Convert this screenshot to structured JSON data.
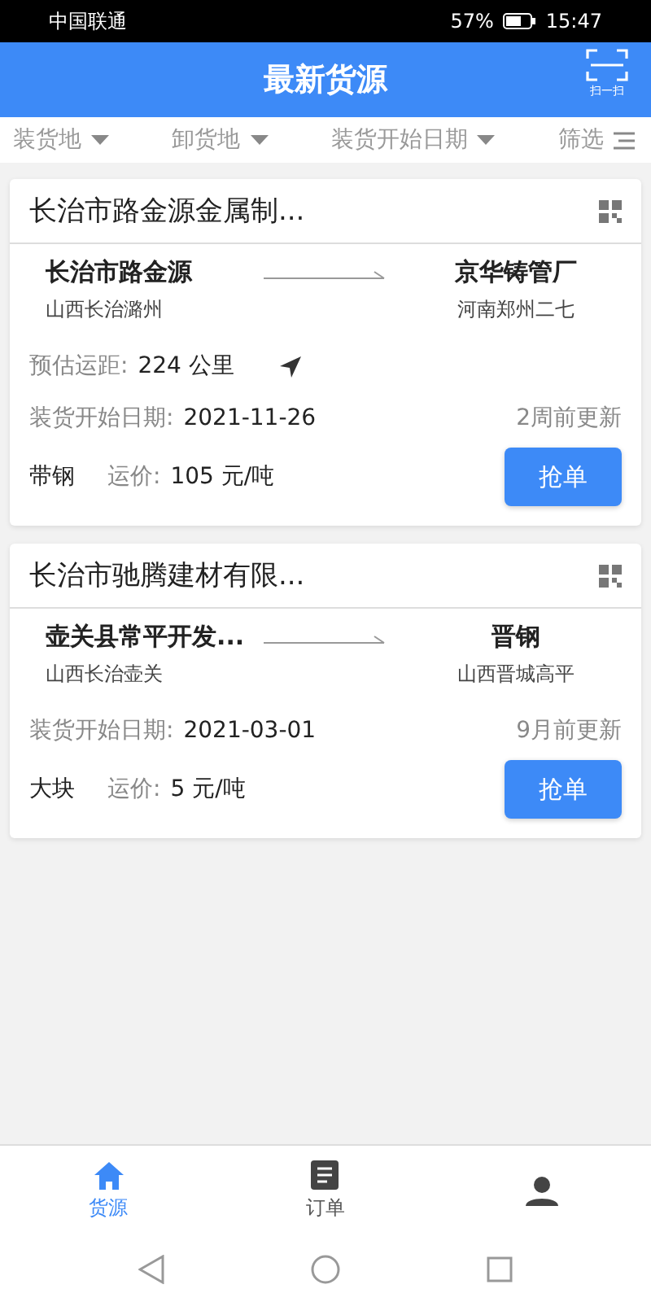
{
  "status_bar": {
    "carrier": "中国联通",
    "battery": "57%",
    "time": "15:47"
  },
  "header": {
    "title": "最新货源",
    "scan_label": "扫一扫"
  },
  "filters": [
    {
      "label": "装货地",
      "kind": "dropdown"
    },
    {
      "label": "卸货地",
      "kind": "dropdown"
    },
    {
      "label": "装货开始日期",
      "kind": "dropdown"
    },
    {
      "label": "筛选",
      "kind": "menu"
    }
  ],
  "cards": [
    {
      "title": "长治市路金源金属制...",
      "from_name": "长治市路金源",
      "from_area": "山西长治潞州",
      "to_name": "京华铸管厂",
      "to_area": "河南郑州二七",
      "distance_label": "预估运距:",
      "distance": "224 公里",
      "date_label": "装货开始日期:",
      "date": "2021-11-26",
      "updated": "2周前更新",
      "goods": "带钢",
      "price_label": "运价:",
      "price": "105 元/吨",
      "button": "抢单"
    },
    {
      "title": "长治市驰腾建材有限...",
      "from_name": "壶关县常平开发...",
      "from_area": "山西长治壶关",
      "to_name": "晋钢",
      "to_area": "山西晋城高平",
      "date_label": "装货开始日期:",
      "date": "2021-03-01",
      "updated": "9月前更新",
      "goods": "大块",
      "price_label": "运价:",
      "price": "5 元/吨",
      "button": "抢单"
    }
  ],
  "tabs": [
    {
      "label": "货源",
      "kind": "home",
      "selected": true
    },
    {
      "label": "订单",
      "kind": "orders",
      "selected": false
    },
    {
      "kind": "profile",
      "selected": false
    }
  ]
}
